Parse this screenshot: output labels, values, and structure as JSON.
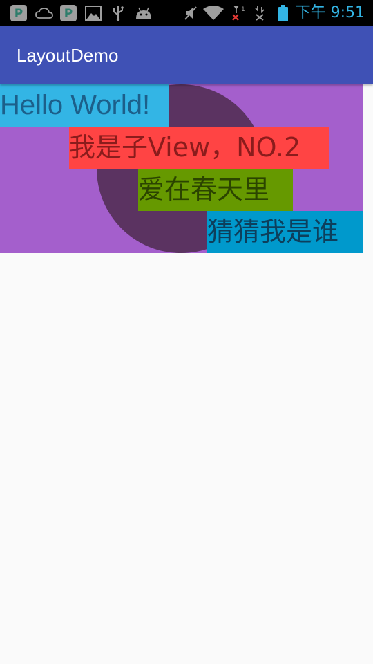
{
  "status_bar": {
    "time": "下午 9:51",
    "signal_label": "1",
    "icons": [
      "pushbullet-icon",
      "cloud-icon",
      "pushbullet-icon",
      "image-icon",
      "usb-icon",
      "android-icon",
      "mute-icon",
      "wifi-icon",
      "signal-icon",
      "data-icon",
      "battery-icon"
    ]
  },
  "app_bar": {
    "title": "LayoutDemo"
  },
  "demo": {
    "child1": "Hello World!",
    "child2": "我是子View，NO.2",
    "child3": "爱在春天里",
    "child4": "猜猜我是谁"
  },
  "colors": {
    "status_bar": "#000000",
    "status_accent": "#33b5e5",
    "app_bar": "#3f51b5",
    "layout_bg": "#a45fcc",
    "circle": "#5b3361",
    "child1_bg": "#33b5e5",
    "child2_bg": "#ff4444",
    "child3_bg": "#669900",
    "child4_bg": "#0099cc",
    "page_bg": "#fafafa"
  }
}
